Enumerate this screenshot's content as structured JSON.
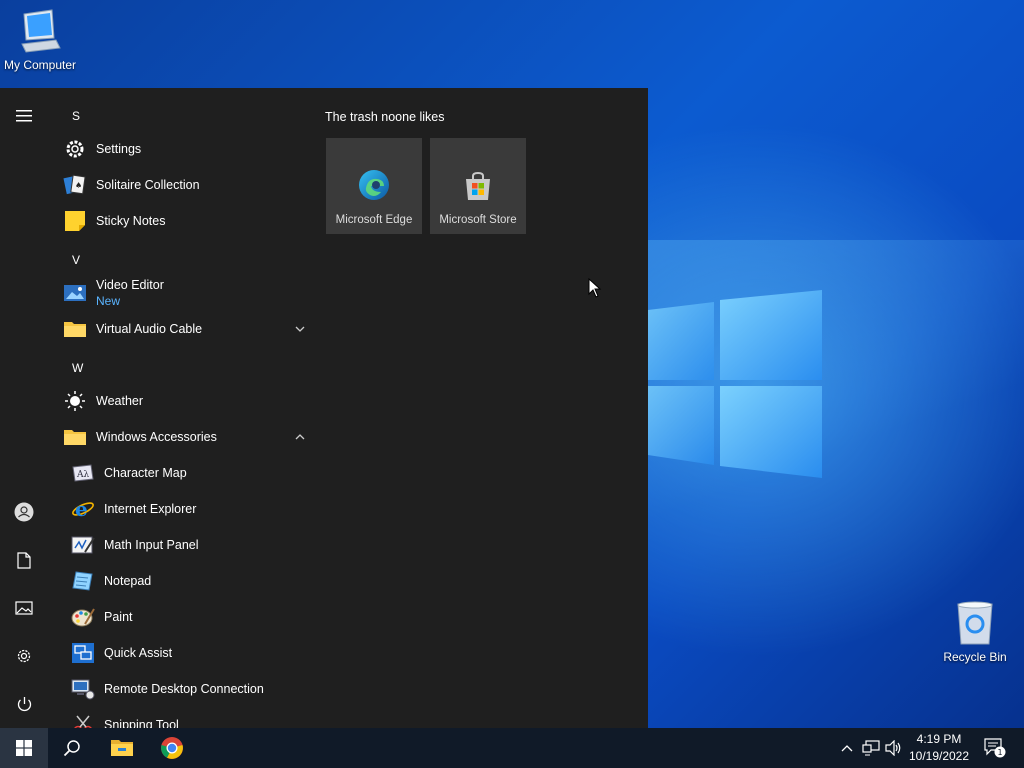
{
  "desktop": {
    "icons": [
      {
        "label": "My Computer"
      },
      {
        "label": "Recycle Bin"
      }
    ]
  },
  "start_menu": {
    "sections": [
      {
        "letter": "S"
      },
      {
        "letter": "V"
      },
      {
        "letter": "W"
      }
    ],
    "apps": {
      "settings": {
        "label": "Settings"
      },
      "solitaire": {
        "label": "Solitaire Collection"
      },
      "sticky_notes": {
        "label": "Sticky Notes"
      },
      "video_editor": {
        "label": "Video Editor",
        "badge": "New"
      },
      "virtual_audio_cable": {
        "label": "Virtual Audio Cable"
      },
      "weather": {
        "label": "Weather"
      },
      "windows_accessories": {
        "label": "Windows Accessories"
      },
      "character_map": {
        "label": "Character Map"
      },
      "internet_explorer": {
        "label": "Internet Explorer"
      },
      "math_input_panel": {
        "label": "Math Input Panel"
      },
      "notepad": {
        "label": "Notepad"
      },
      "paint": {
        "label": "Paint"
      },
      "quick_assist": {
        "label": "Quick Assist"
      },
      "remote_desktop": {
        "label": "Remote Desktop Connection"
      },
      "snipping_tool": {
        "label": "Snipping Tool"
      }
    },
    "tile_group": {
      "title": "The trash noone likes",
      "tiles": [
        {
          "label": "Microsoft Edge"
        },
        {
          "label": "Microsoft Store"
        }
      ]
    },
    "rail_icons": [
      "hamburger-icon",
      "user-icon",
      "document-icon",
      "pictures-icon",
      "gear-icon",
      "power-icon"
    ]
  },
  "taskbar": {
    "clock": {
      "time": "4:19 PM",
      "date": "10/19/2022"
    },
    "notification_count": "1"
  },
  "colors": {
    "start_bg": "#1f1f1f",
    "tile_bg": "#3a3a3a",
    "accent_blue": "#5ab4ff",
    "taskbar_bg": "#101a28"
  }
}
